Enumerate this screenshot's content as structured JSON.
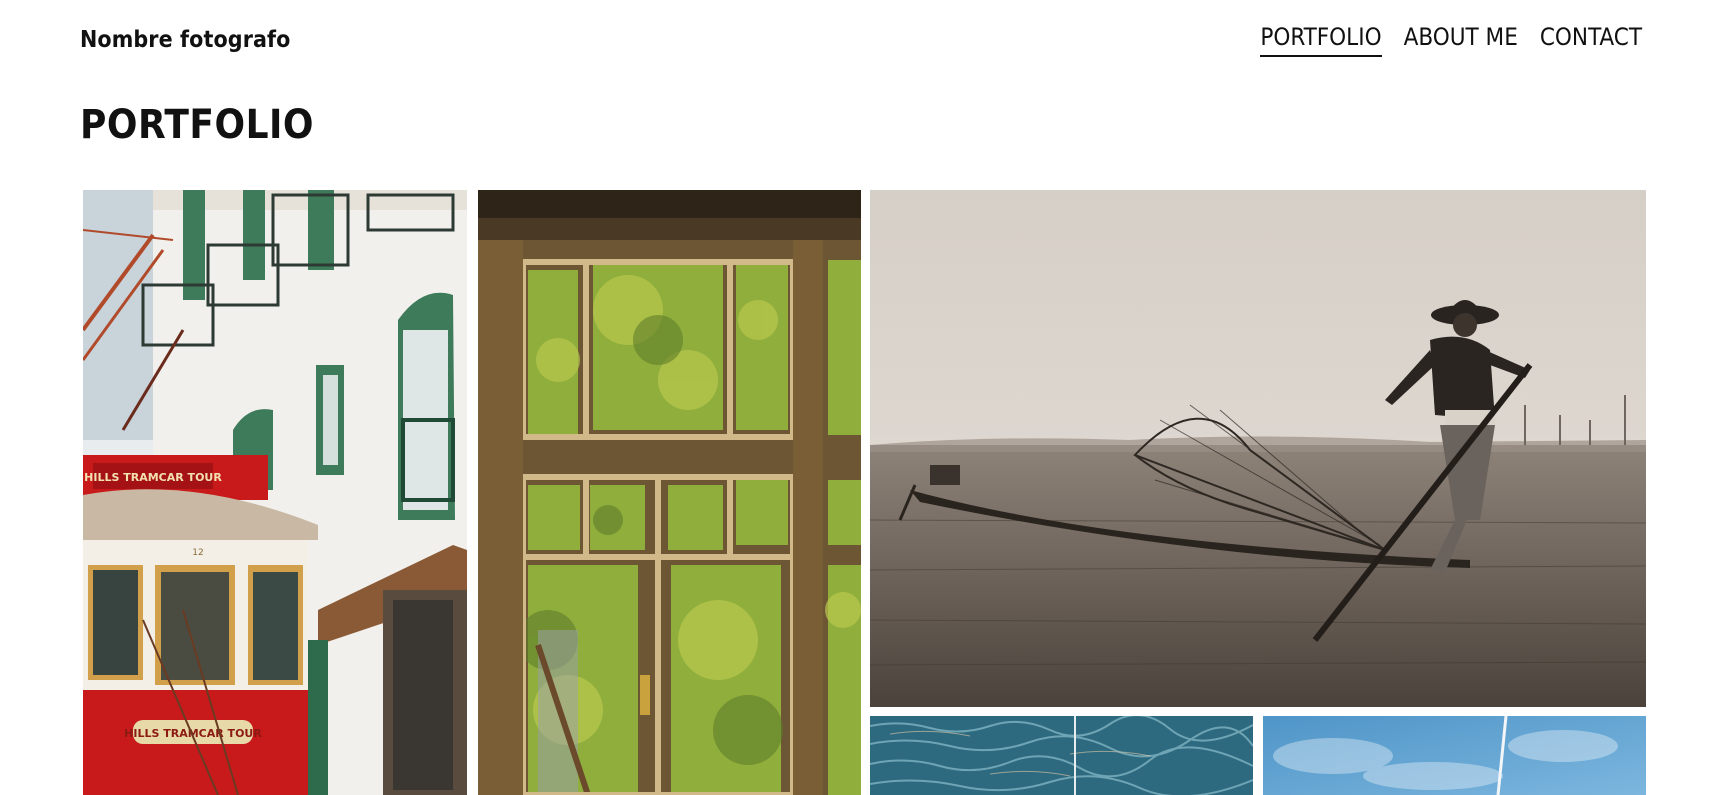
{
  "site": {
    "brand": "Nombre fotografo"
  },
  "nav": {
    "items": [
      {
        "label": "PORTFOLIO",
        "active": true
      },
      {
        "label": "ABOUT ME",
        "active": false
      },
      {
        "label": "CONTACT",
        "active": false
      }
    ]
  },
  "main": {
    "title": "PORTFOLIO"
  },
  "gallery": {
    "photos": [
      {
        "name": "tram-street-photo",
        "sign_top": "HILLS TRAMCAR TOUR",
        "sign_bottom": "HILLS TRAMCAR TOUR",
        "tram_number": "12"
      },
      {
        "name": "window-trees-photo"
      },
      {
        "name": "fisherman-boat-photo"
      },
      {
        "name": "water-waves-photo"
      },
      {
        "name": "sky-sail-photo"
      }
    ]
  },
  "colors": {
    "text": "#111111",
    "background": "#ffffff",
    "tram_red": "#c8191b",
    "window_frame": "#8a6a3b",
    "foliage": "#8fae3c",
    "sepia_sky": "#d9d2ca",
    "sea_blue": "#2d6a80",
    "sky_blue": "#4f95c8"
  }
}
